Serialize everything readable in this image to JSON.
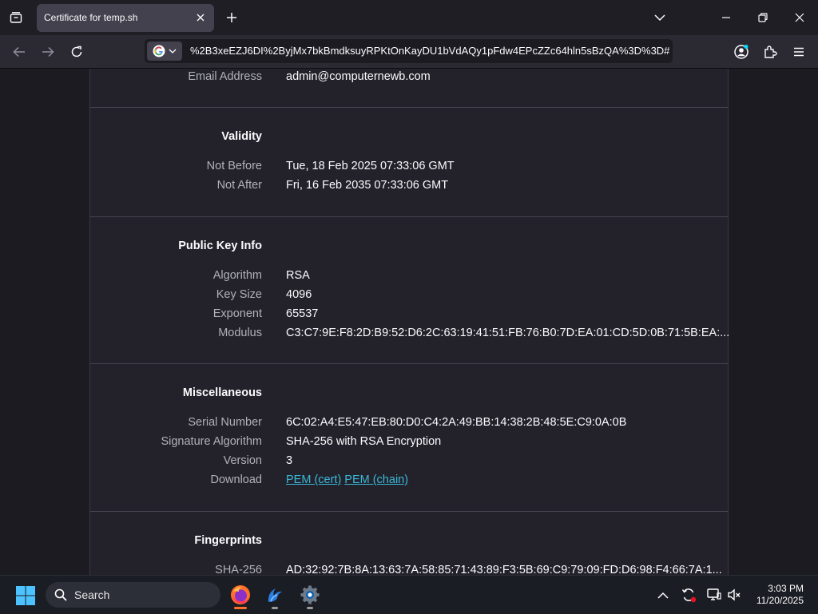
{
  "tab": {
    "title": "Certificate for temp.sh"
  },
  "url": "%2B3xeEZJ6DI%2ByjMx7bkBmdksuyRPKtOnKayDU1bVdAQy1pFdw4EPcZZc64hln5sBzQA%3D%3D#",
  "subject_tail": {
    "label": "Email Address",
    "value": "admin@computernewb.com"
  },
  "validity": {
    "title": "Validity",
    "rows": [
      {
        "label": "Not Before",
        "value": "Tue, 18 Feb 2025 07:33:06 GMT"
      },
      {
        "label": "Not After",
        "value": "Fri, 16 Feb 2035 07:33:06 GMT"
      }
    ]
  },
  "public_key": {
    "title": "Public Key Info",
    "rows": [
      {
        "label": "Algorithm",
        "value": "RSA"
      },
      {
        "label": "Key Size",
        "value": "4096"
      },
      {
        "label": "Exponent",
        "value": "65537"
      },
      {
        "label": "Modulus",
        "value": "C3:C7:9E:F8:2D:B9:52:D6:2C:63:19:41:51:FB:76:B0:7D:EA:01:CD:5D:0B:71:5B:EA:..."
      }
    ]
  },
  "misc": {
    "title": "Miscellaneous",
    "rows": [
      {
        "label": "Serial Number",
        "value": "6C:02:A4:E5:47:EB:80:D0:C4:2A:49:BB:14:38:2B:48:5E:C9:0A:0B"
      },
      {
        "label": "Signature Algorithm",
        "value": "SHA-256 with RSA Encryption"
      },
      {
        "label": "Version",
        "value": "3"
      }
    ],
    "download": {
      "label": "Download",
      "pem_cert": "PEM (cert)",
      "pem_chain": "PEM (chain)"
    }
  },
  "fingerprints": {
    "title": "Fingerprints",
    "rows": [
      {
        "label": "SHA-256",
        "value": "AD:32:92:7B:8A:13:63:7A:58:85:71:43:89:F3:5B:69:C9:79:09:FD:D6:98:F4:66:7A:1..."
      }
    ]
  },
  "taskbar": {
    "search_placeholder": "Search",
    "time": "3:03 PM",
    "date": "11/20/2025"
  },
  "colors": {
    "link": "#3ab8d8",
    "accent": "#0078d4",
    "panel": "#23222b"
  }
}
